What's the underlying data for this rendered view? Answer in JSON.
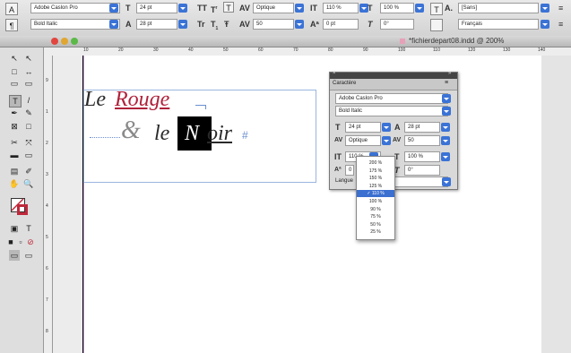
{
  "control_bar": {
    "font_family": "Adobe Caslon Pro",
    "font_style": "Bold Italic",
    "font_size": "24 pt",
    "leading": "28 pt",
    "kerning_label": "Optique",
    "tracking": "50",
    "vertical_scale": "110 %",
    "horizontal_scale": "100 %",
    "baseline_shift": "0 pt",
    "skew": "0°",
    "char_style": "[Sans]",
    "language": "Français"
  },
  "window": {
    "title": "*fichierdepart08.indd @ 200%"
  },
  "ruler_ticks": [
    "10",
    "20",
    "30",
    "40",
    "50",
    "60",
    "70",
    "80",
    "90",
    "100",
    "110",
    "120",
    "130",
    "140",
    "150"
  ],
  "canvas": {
    "line1_le": "Le",
    "line1_rouge": "Rouge",
    "line2_amp": "&",
    "line2_le": "le",
    "line2_n": "N",
    "line2_oir": "oir",
    "line2_hash": "#"
  },
  "panel": {
    "title": "Caractère",
    "font_family": "Adobe Caslon Pro",
    "font_style": "Bold Italic",
    "font_size": "24 pt",
    "leading": "28 pt",
    "kerning": "Optique",
    "tracking": "50",
    "vertical_scale": "110 %",
    "horizontal_scale": "100 %",
    "baseline_shift": "0",
    "skew": "0°",
    "language_label": "Langue"
  },
  "scale_options": [
    "200 %",
    "175 %",
    "150 %",
    "125 %",
    "110 %",
    "100 %",
    "90 %",
    "75 %",
    "50 %",
    "25 %"
  ],
  "selected_option_index": 4,
  "colors": {
    "accent_red": "#b0213a",
    "text_dark": "#2a2a2a",
    "guide_blue": "#9ab6e0",
    "selection_blue": "#3b6fd0"
  }
}
